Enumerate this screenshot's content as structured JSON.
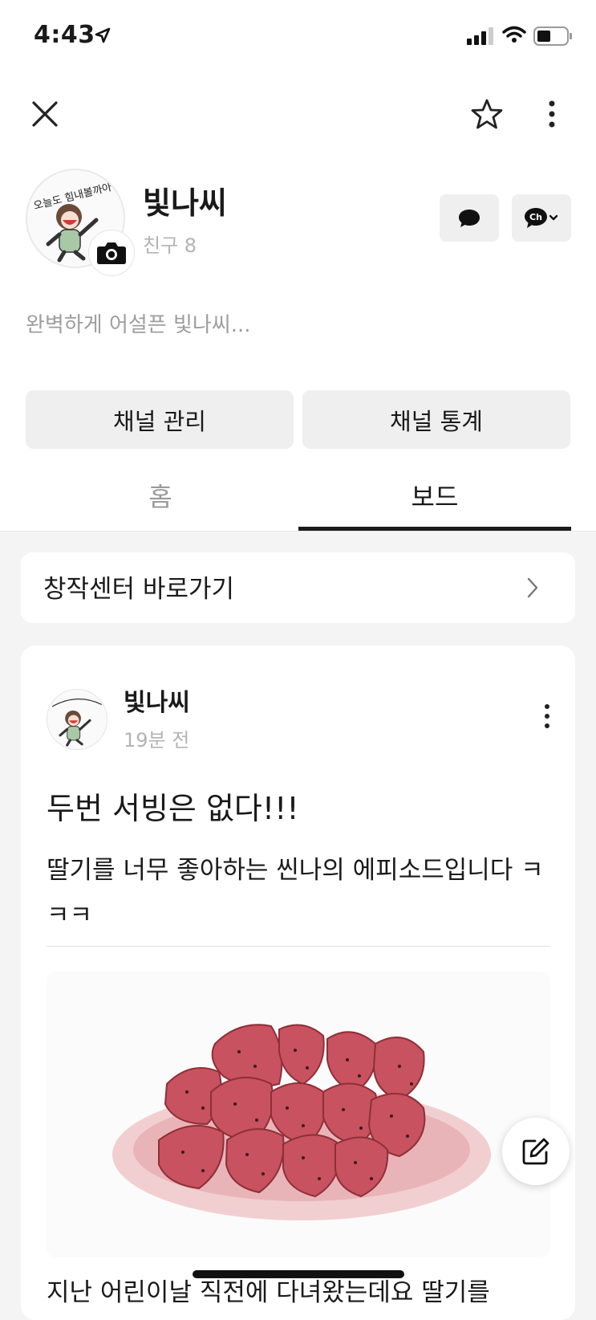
{
  "status_bar": {
    "time": "4:43"
  },
  "profile": {
    "name": "빛나씨",
    "friend_count": "친구 8",
    "status_message": "완벽하게 어설픈 빛나씨...",
    "avatar_caption": "오늘도 힘내볼까아~",
    "chat_button_icon": "chat-bubble-icon",
    "channel_button_label": "Ch"
  },
  "actions": {
    "manage": "채널 관리",
    "stats": "채널 통계"
  },
  "tabs": {
    "home": "홈",
    "board": "보드",
    "active": "board"
  },
  "creator_center": {
    "label": "창작센터 바로가기"
  },
  "post": {
    "author": "빛나씨",
    "time": "19분 전",
    "title": "두번 서빙은 없다!!!",
    "body": "딸기를 너무 좋아하는 씬나의 에피소드입니다 ㅋㅋㅋ",
    "next_text": "지난 어린이날 직전에 다녀왔는데요 딸기를"
  },
  "colors": {
    "accent": "#1a1a1a",
    "muted": "#b3b3b3",
    "button_bg": "#efefef",
    "strawberry": "#c8525f"
  }
}
